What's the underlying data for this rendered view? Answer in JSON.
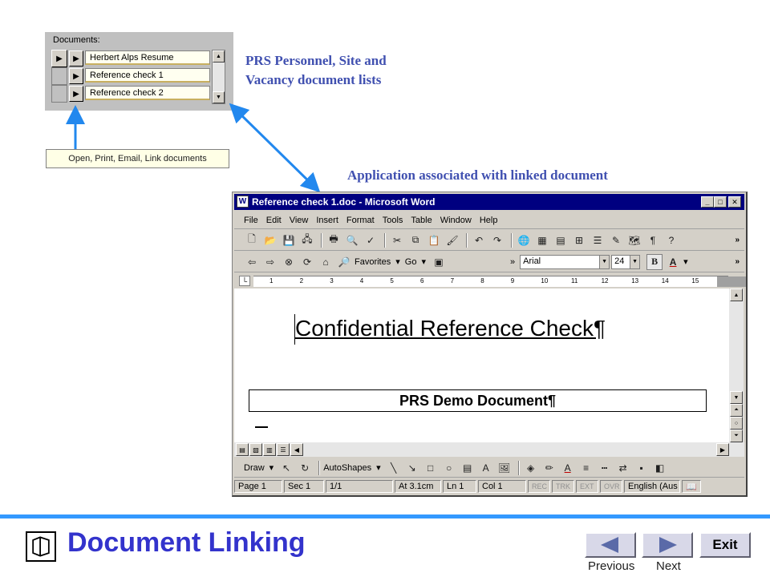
{
  "documents_panel": {
    "title": "Documents:",
    "items": [
      {
        "name": "Herbert Alps Resume"
      },
      {
        "name": "Reference check 1"
      },
      {
        "name": "Reference check 2"
      }
    ]
  },
  "annotations": {
    "lists_line1": "PRS Personnel, Site and",
    "lists_line2": "Vacancy document lists",
    "application": "Application associated with linked document",
    "callout": "Open, Print, Email, Link documents"
  },
  "word": {
    "title": "Reference check 1.doc - Microsoft Word",
    "menu": [
      "File",
      "Edit",
      "View",
      "Insert",
      "Format",
      "Tools",
      "Table",
      "Window",
      "Help"
    ],
    "web_toolbar": {
      "favorites": "Favorites",
      "go": "Go"
    },
    "font_name": "Arial",
    "font_size": "24",
    "bold_label": "B",
    "font_color_label": "A",
    "ruler_labels": [
      "1",
      "2",
      "3",
      "4",
      "5",
      "6",
      "7",
      "8",
      "9",
      "10",
      "11",
      "12",
      "13",
      "14",
      "15"
    ],
    "document": {
      "heading": "Confidential Reference Check¶",
      "box_text": "PRS Demo Document¶"
    },
    "drawing_toolbar": {
      "draw": "Draw",
      "autoshapes": "AutoShapes"
    },
    "status": {
      "page": "Page 1",
      "sec": "Sec 1",
      "pages": "1/1",
      "at": "At 3.1cm",
      "ln": "Ln 1",
      "col": "Col 1",
      "rec": "REC",
      "trk": "TRK",
      "ext": "EXT",
      "ovr": "OVR",
      "language": "English (Aus"
    }
  },
  "footer": {
    "title": "Document Linking",
    "previous": "Previous",
    "next": "Next",
    "exit": "Exit"
  },
  "colors": {
    "annotation_text": "#4050b0",
    "arrow": "#2288ee",
    "footer_line": "#3399ff",
    "title_text": "#3333cc",
    "titlebar": "#000080"
  }
}
